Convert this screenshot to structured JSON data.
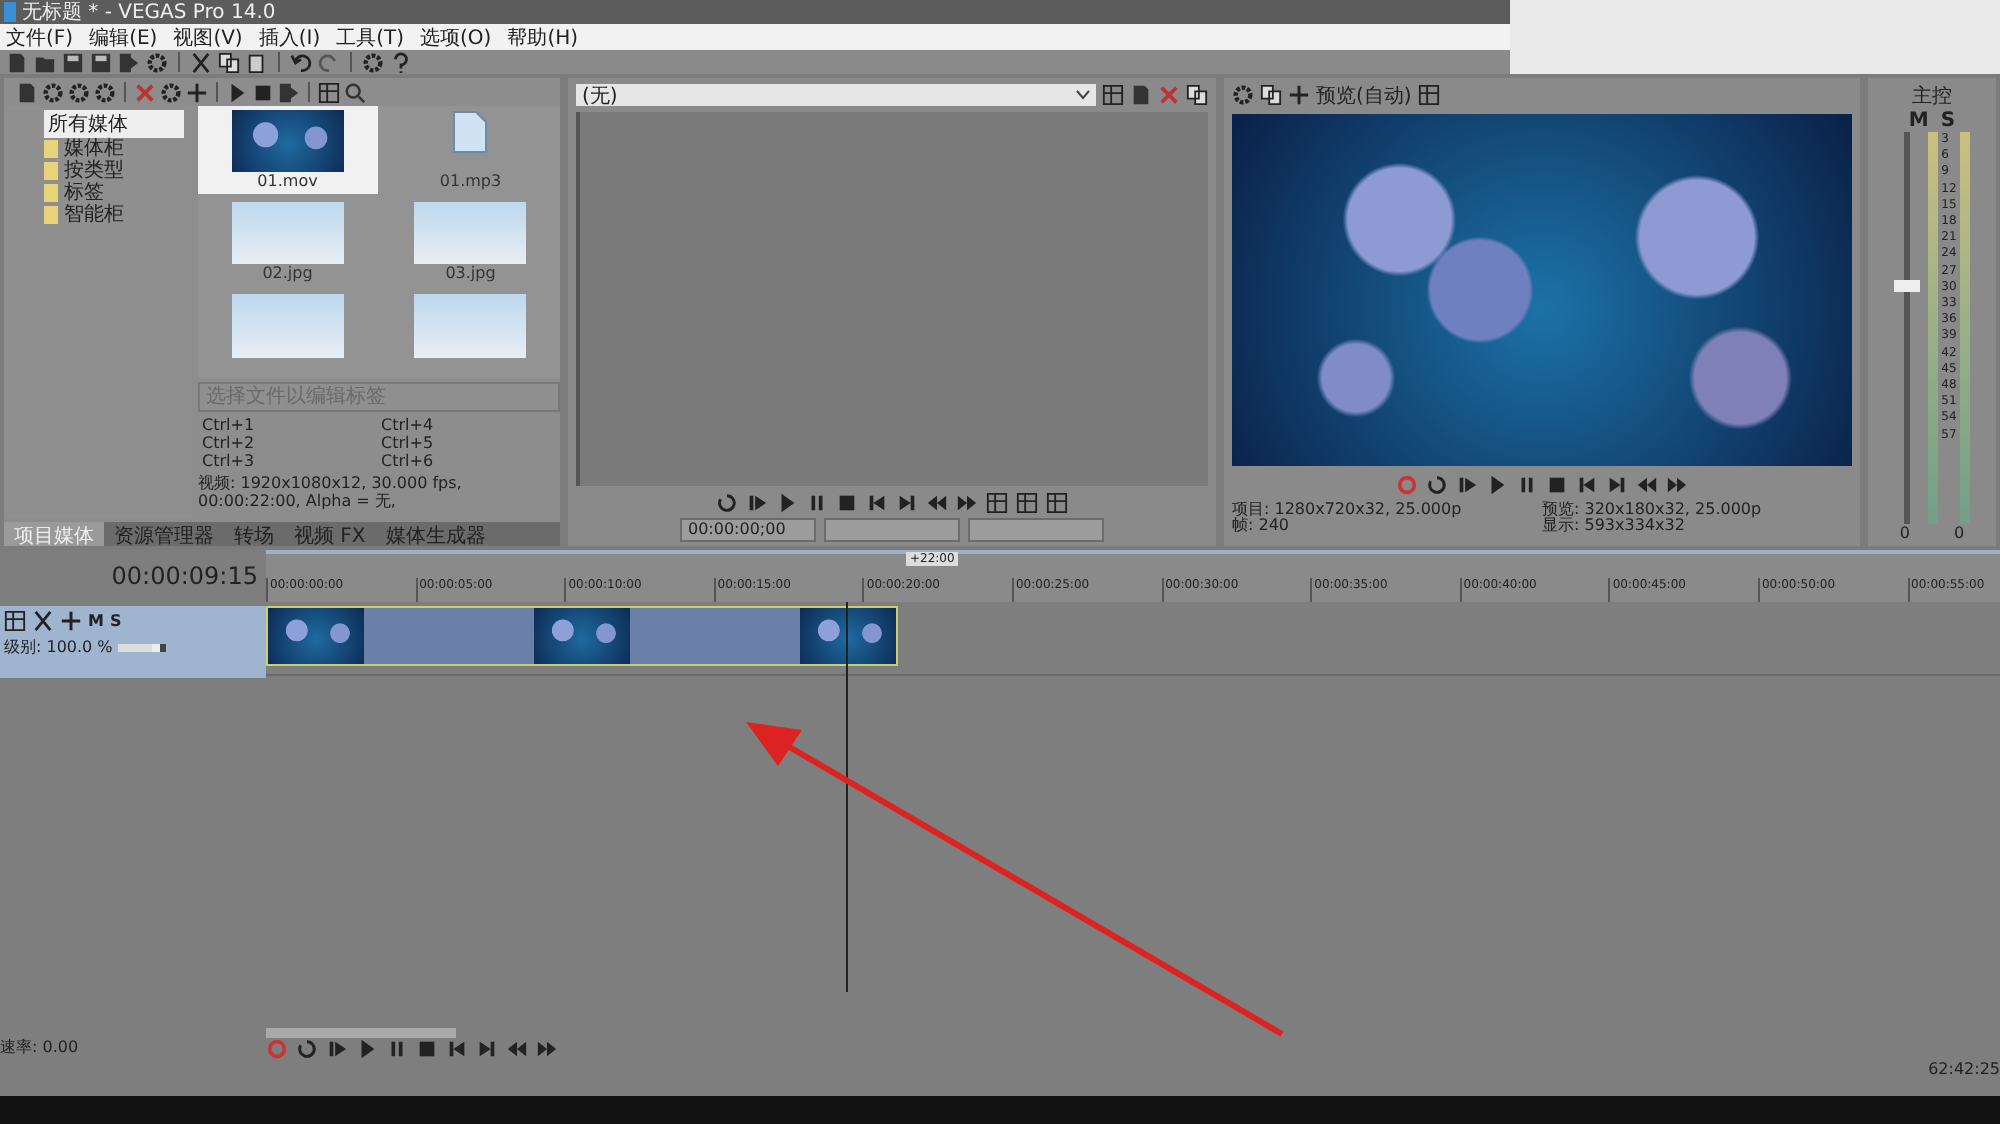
{
  "window": {
    "title": "无标题 * - VEGAS Pro 14.0"
  },
  "menu": [
    "文件(F)",
    "编辑(E)",
    "视图(V)",
    "插入(I)",
    "工具(T)",
    "选项(O)",
    "帮助(H)"
  ],
  "media_tree": {
    "label": "所有媒体",
    "selected": true,
    "children": [
      {
        "label": "媒体柜"
      },
      {
        "label": "按类型"
      },
      {
        "label": "标签"
      },
      {
        "label": "智能柜"
      }
    ]
  },
  "media_files": [
    {
      "kind": "video",
      "name": "01.mov",
      "selected": true
    },
    {
      "kind": "audio",
      "name": "01.mp3",
      "selected": false
    },
    {
      "kind": "photo",
      "name": "02.jpg",
      "selected": false
    },
    {
      "kind": "photo",
      "name": "03.jpg",
      "selected": false
    },
    {
      "kind": "photo",
      "selected": false
    },
    {
      "kind": "photo",
      "selected": false
    }
  ],
  "tag_search": {
    "placeholder": "选择文件以编辑标签"
  },
  "shortcuts": [
    "Ctrl+1",
    "Ctrl+4",
    "Ctrl+2",
    "Ctrl+5",
    "Ctrl+3",
    "Ctrl+6"
  ],
  "media_info": "视频: 1920x1080x12, 30.000 fps, 00:00:22:00, Alpha = 无,",
  "panel_tabs": [
    {
      "label": "项目媒体",
      "selected": true
    },
    {
      "label": "资源管理器",
      "selected": false
    },
    {
      "label": "转场",
      "selected": false
    },
    {
      "label": "视频 FX",
      "selected": false
    },
    {
      "label": "媒体生成器",
      "selected": false
    }
  ],
  "trimmer": {
    "source": "(无)",
    "time": "00:00:00;00"
  },
  "preview": {
    "quality": "预览(自动)",
    "info": [
      {
        "label": "项目:",
        "value": "1280x720x32, 25.000p"
      },
      {
        "label": "预览:",
        "value": "320x180x32, 25.000p"
      },
      {
        "label": "帧:",
        "value": "240"
      },
      {
        "label": "显示:",
        "value": "593x334x32"
      }
    ]
  },
  "master": {
    "title": "主控",
    "mute": "M",
    "solo": "S",
    "level": 0.62,
    "scale": [
      "3",
      "6",
      "9",
      "12",
      "15",
      "18",
      "21",
      "24",
      "27",
      "30",
      "33",
      "36",
      "39",
      "42",
      "45",
      "48",
      "51",
      "54",
      "57"
    ],
    "peaks": [
      "0",
      "0"
    ]
  },
  "timeline": {
    "time": "00:00:09:15",
    "loop_end": "+22:00",
    "ruler": [
      "00:00:00:00",
      "00:00:05:00",
      "00:00:10:00",
      "00:00:15:00",
      "00:00:20:00",
      "00:00:25:00",
      "00:00:30:00",
      "00:00:35:00",
      "00:00:40:00",
      "00:00:45:00",
      "00:00:50:00",
      "00:00:55:00"
    ]
  },
  "track": {
    "mute": "M",
    "solo": "S",
    "level_label": "级别: 100.0 %",
    "level": 0.85,
    "selected": true
  },
  "rate": "速率: 0.00",
  "record_time": "62:42:25"
}
